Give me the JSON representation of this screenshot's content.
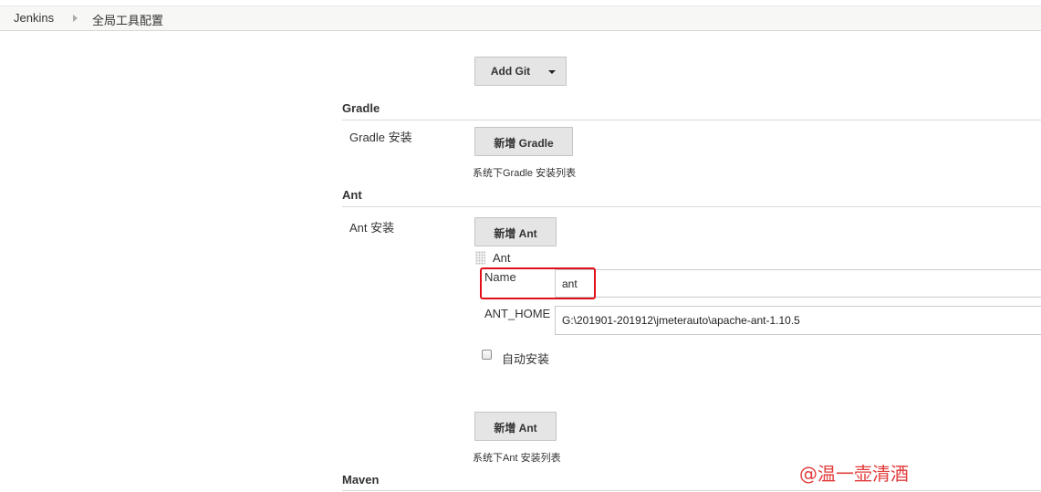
{
  "breadcrumb": {
    "items": [
      "Jenkins",
      "全局工具配置"
    ]
  },
  "git": {
    "add_button": "Add Git"
  },
  "gradle": {
    "section_title": "Gradle",
    "install_label": "Gradle 安装",
    "add_button": "新增 Gradle",
    "help": "系统下Gradle 安装列表"
  },
  "ant": {
    "section_title": "Ant",
    "install_label": "Ant 安装",
    "add_button_top": "新增 Ant",
    "installation_title": "Ant",
    "name_label": "Name",
    "name_value": "ant",
    "home_label": "ANT_HOME",
    "home_value": "G:\\201901-201912\\jmeterauto\\apache-ant-1.10.5",
    "auto_install_label": "自动安装",
    "auto_install_checked": false,
    "add_button_bottom": "新增 Ant",
    "help": "系统下Ant 安装列表"
  },
  "maven": {
    "section_title": "Maven"
  },
  "watermark": "@温一壶清酒",
  "colors": {
    "highlight": "#e0101a",
    "watermark": "#e23b3b"
  }
}
